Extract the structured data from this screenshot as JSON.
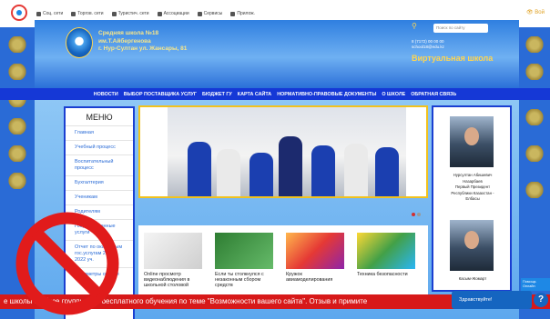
{
  "topbar": {
    "items": [
      "Соц. сети",
      "Торгов. сети",
      "Туристич. сети",
      "Ассоциации",
      "Сервисы",
      "Прилож."
    ],
    "right_label": "Вой"
  },
  "header": {
    "school_name_lines": [
      "Средняя школа №18",
      "им.Т.Айбергенова",
      "г. Нур-Султан ул. Жансары, 81"
    ],
    "search_placeholder": "Поиск по сайту",
    "contacts": [
      "8 (7172) 00 00 00",
      "school18@edu.kz"
    ],
    "virtual_school": "Виртуальная школа"
  },
  "nav": [
    "НОВОСТИ",
    "ВЫБОР ПОСТАВЩИКА УСЛУГ",
    "БЮДЖЕТ ГУ",
    "КАРТА САЙТА",
    "НОРМАТИВНО-ПРАВОВЫЕ ДОКУМЕНТЫ",
    "О ШКОЛЕ",
    "ОБРАТНАЯ СВЯЗЬ"
  ],
  "menu": {
    "title": "МЕНЮ",
    "items": [
      "Главная",
      "Учебный процесс",
      "Воспитательный процесс",
      "Бухгалтерия",
      "Ученикам",
      "Родителям",
      "Государственные услуги",
      "Отчет по оказанным гос.услугам 2021-2022 уч.",
      "Параметры отчеты"
    ]
  },
  "cards": [
    {
      "caption": "Online просмотр видеонаблюдения в школьной столовой"
    },
    {
      "caption": "Если ты столкнулся с незаконным сбором средств"
    },
    {
      "caption": "Кружок авиамоделирования"
    },
    {
      "caption": "Техника безопасности"
    }
  ],
  "right_panel": {
    "first_caption": [
      "Нурсултан Абишевич",
      "Назарбаев",
      "Первый Президент",
      "Республики Казахстан -",
      "Елбасы"
    ],
    "second_caption": "Касым-Жомарт"
  },
  "ticker": "е школы на базе группы для бесплатного обучения по теме \"Возможности вашего сайта\". Отзыв и примите",
  "chat": {
    "label": "Здравствуйте!",
    "badge": "?"
  },
  "help": "Помощь Онлайн"
}
